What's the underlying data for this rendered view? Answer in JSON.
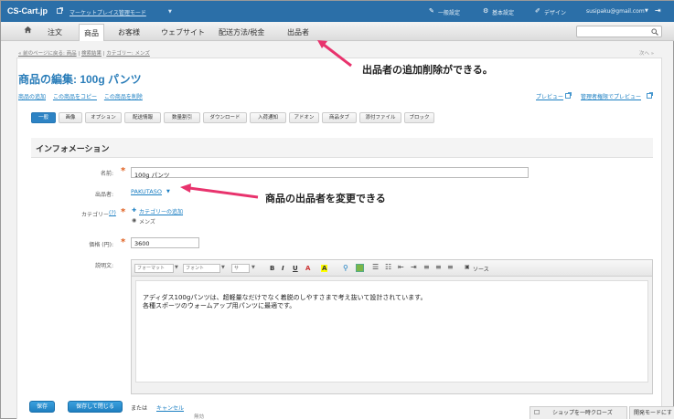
{
  "topbar": {
    "logo": "CS-Cart.jp",
    "marketplace_link": "マーケットプレイス管理モード",
    "general_settings": "一般設定",
    "basic_settings": "基本設定",
    "design": "デザイン",
    "user_email": "susipaku@gmail.com"
  },
  "nav": {
    "items": [
      "注文",
      "商品",
      "お客様",
      "ウェブサイト",
      "配送方法/税金",
      "出品者"
    ],
    "active": "商品"
  },
  "breadcrumb": {
    "back": "« 前のページに戻る: 商品",
    "search_results": "検索結果",
    "category": "カテゴリー: メンズ",
    "next": "次へ »"
  },
  "page": {
    "title": "商品の編集: 100g パンツ",
    "links": [
      "商品の追加",
      "この商品をコピー",
      "この商品を削除"
    ],
    "preview": "プレビュー",
    "admin_preview": "管理者権限でプレビュー"
  },
  "tabs": [
    "一般",
    "画像",
    "オプション",
    "配送情報",
    "数量割引",
    "ダウンロード",
    "入荷通知",
    "アドオン",
    "商品タブ",
    "添付ファイル",
    "ブロック"
  ],
  "section": {
    "title": "インフォメーション"
  },
  "form": {
    "name_label": "名前:",
    "name_value": "100g パンツ",
    "vendor_label": "出品者:",
    "vendor_value": "PAKUTASO",
    "category_label": "カテゴリー",
    "category_help": "(?)",
    "category_add": "カテゴリーの追加",
    "category_item": "メンズ",
    "price_label": "価格 (円):",
    "price_value": "3600",
    "description_label": "説明文:"
  },
  "editor": {
    "format": "フォーマット",
    "font": "フォント",
    "size": "サ",
    "source": "ソース",
    "text_line1": "アディダス100gパンツは、超軽量なだけでなく着脱のしやすさまで考え抜いて設計されています。",
    "text_line2": "各種スポーツのウォームアップ用パンツに最適です。"
  },
  "annotations": {
    "top": "出品者の追加削除ができる。",
    "middle": "商品の出品者を変更できる"
  },
  "footer": {
    "save": "保存",
    "save_close": "保存して閉じる",
    "or": "または",
    "cancel": "キャンセル",
    "status_partial": "無効",
    "shop_close": "ショップを一時クローズ",
    "dev_mode": "開発モードにす"
  },
  "colors": {
    "topbar": "#2b6fa8",
    "accent": "#2a7db9",
    "annotation_arrow": "#e8336d"
  }
}
